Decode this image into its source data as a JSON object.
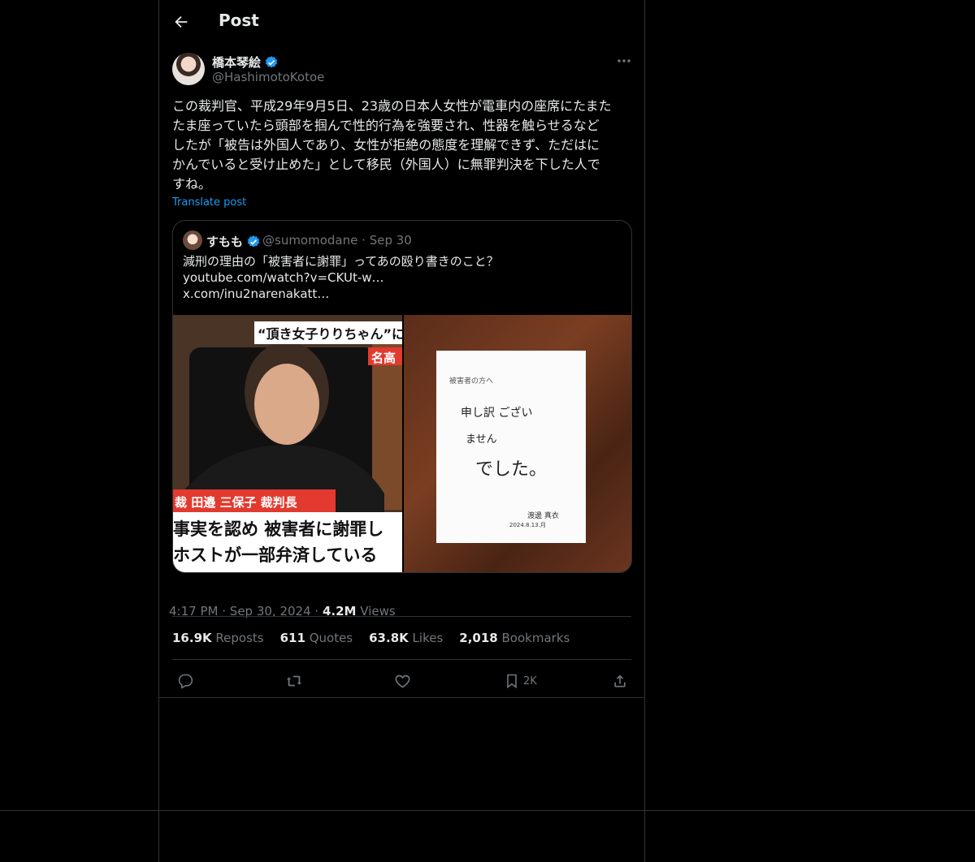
{
  "header": {
    "title": "Post"
  },
  "author": {
    "name": "橋本琴絵",
    "handle": "@HashimotoKotoe"
  },
  "post": {
    "lines": [
      "この裁判官、平成29年9月5日、23歳の日本人女性が電車内の座席にたまた",
      "たま座っていたら頭部を掴んで性的行為を強要され、性器を触らせるなど",
      "したが「被告は外国人であり、女性が拒絶の態度を理解できず、ただはに",
      "かんでいると受け止めた」として移民（外国人）に無罪判決を下した人で",
      "すね。"
    ],
    "translate": "Translate post"
  },
  "quote": {
    "name": "すもも",
    "handle": "@sumomodane",
    "date": "Sep 30",
    "lines": [
      "減刑の理由の「被害者に謝罪」ってあの殴り書きのこと？",
      "youtube.com/watch?v=CKUt-w…",
      "x.com/inu2narenakatt…"
    ],
    "image_left": {
      "caption_top": "“頂き女子りりちゃん”に",
      "caption_top_right": "名高",
      "nameplate": "裁 田邉 三保子 裁判長",
      "line1": "事実を認め 被害者に謝罪し",
      "line2": "ホストが一部弁済している"
    },
    "image_right": {
      "note_header": "被害者の方へ",
      "note_l1": "申し訳 ござい",
      "note_l2": "ません",
      "note_l3": "でした。",
      "note_sign": "渡邊 真衣",
      "note_date": "2024.8.13.月"
    }
  },
  "meta": {
    "time": "4:17 PM",
    "date": "Sep 30, 2024",
    "views": "4.2M",
    "views_label": "Views",
    "sep": "·"
  },
  "stats": {
    "reposts": "16.9K",
    "reposts_label": "Reposts",
    "quotes": "611",
    "quotes_label": "Quotes",
    "likes": "63.8K",
    "likes_label": "Likes",
    "bookmarks": "2,018",
    "bookmarks_label": "Bookmarks"
  },
  "actions": {
    "bookmark_count": "2K"
  },
  "colors": {
    "accent": "#1d9bf0",
    "muted": "#71767b",
    "border": "#2f3336"
  }
}
